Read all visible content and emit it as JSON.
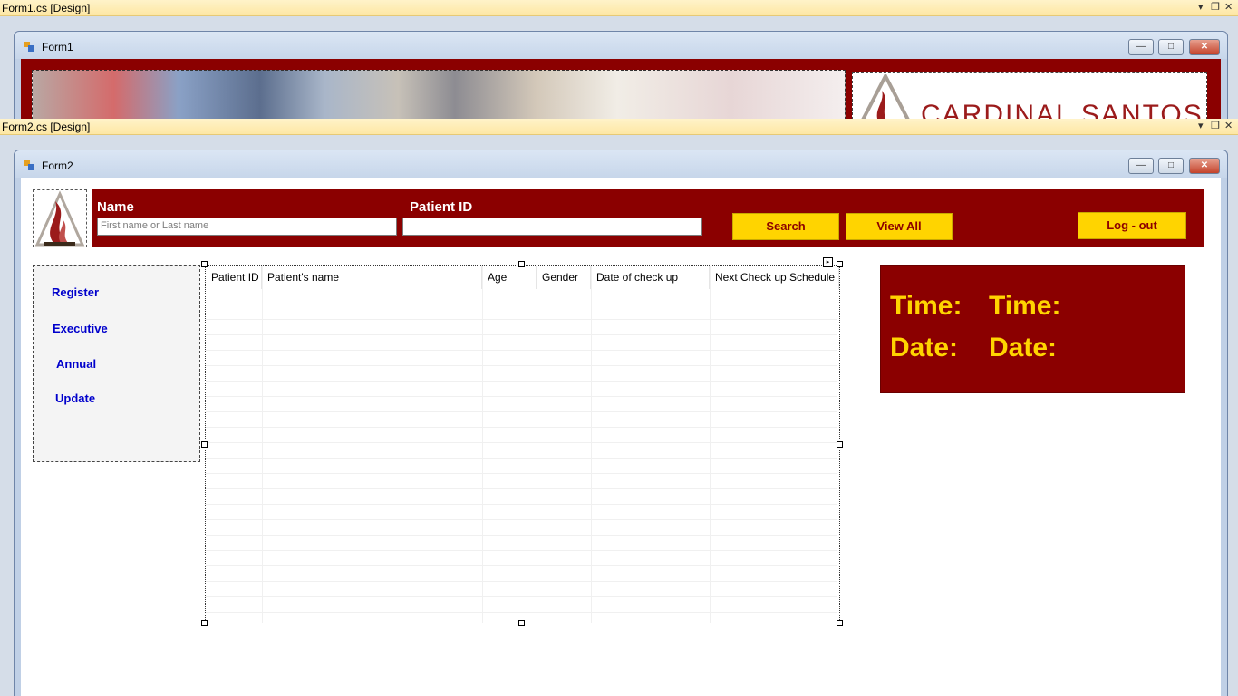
{
  "form1_tab": {
    "title": "Form1.cs [Design]",
    "dropdown": "▾",
    "restore": "❐",
    "close": "✕"
  },
  "form1": {
    "title": "Form1",
    "brand": "CARDINAL SANTOS",
    "min": "—",
    "max": "□",
    "close": "✕"
  },
  "form2_tab": {
    "title": "Form2.cs [Design]",
    "dropdown": "▾",
    "restore": "❐",
    "close": "✕"
  },
  "form2": {
    "title": "Form2",
    "min": "—",
    "max": "□",
    "close": "✕",
    "header": {
      "name_label": "Name",
      "name_placeholder": "First name or Last name",
      "patient_id_label": "Patient ID",
      "search_button": "Search",
      "view_all_button": "View All",
      "logout_button": "Log - out"
    },
    "sidebar": {
      "items": [
        {
          "label": "Register"
        },
        {
          "label": "Executive"
        },
        {
          "label": "Annual"
        },
        {
          "label": "Update"
        }
      ]
    },
    "grid": {
      "columns": [
        "Patient ID",
        "Patient's name",
        "Age",
        "Gender",
        "Date of check up",
        "Next Check up Schedule"
      ]
    },
    "clock": {
      "time_label": "Time:",
      "time_value": "Time:",
      "date_label": "Date:",
      "date_value": "Date:"
    }
  },
  "colors": {
    "brand_red": "#8b0000",
    "accent_yellow": "#ffd400",
    "link_blue": "#0000cc"
  }
}
